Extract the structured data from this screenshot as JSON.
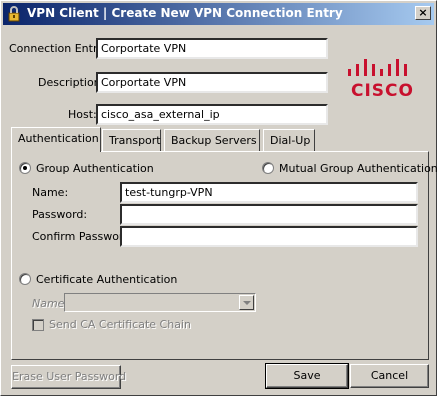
{
  "window": {
    "title": "VPN Client  |  Create New VPN Connection Entry",
    "close_glyph": "×"
  },
  "form": {
    "connection_entry_label": "Connection Entry:",
    "connection_entry_value": "Corportate VPN",
    "description_label": "Description:",
    "description_value": "Corportate VPN",
    "host_label": "Host:",
    "host_value": "cisco_asa_external_ip"
  },
  "logo": {
    "text": "CISCO",
    "color": "#c8102e",
    "icon": "cisco-bridge-logo"
  },
  "tabs": [
    {
      "label": "Authentication",
      "active": true
    },
    {
      "label": "Transport",
      "active": false
    },
    {
      "label": "Backup Servers",
      "active": false
    },
    {
      "label": "Dial-Up",
      "active": false
    }
  ],
  "auth": {
    "group_auth_label": "Group Authentication",
    "group_auth_selected": true,
    "mutual_auth_label": "Mutual Group Authentication",
    "mutual_auth_selected": false,
    "name_label": "Name:",
    "name_value": "test-tungrp-VPN",
    "password_label": "Password:",
    "password_value": "",
    "confirm_password_label": "Confirm Password:",
    "confirm_password_value": "",
    "cert_auth_label": "Certificate Authentication",
    "cert_auth_selected": false,
    "cert_name_label": "Name:",
    "cert_name_value": "",
    "send_ca_chain_label": "Send CA Certificate Chain",
    "send_ca_chain_checked": false
  },
  "buttons": {
    "erase_password": "Erase User Password",
    "save": "Save",
    "cancel": "Cancel"
  }
}
